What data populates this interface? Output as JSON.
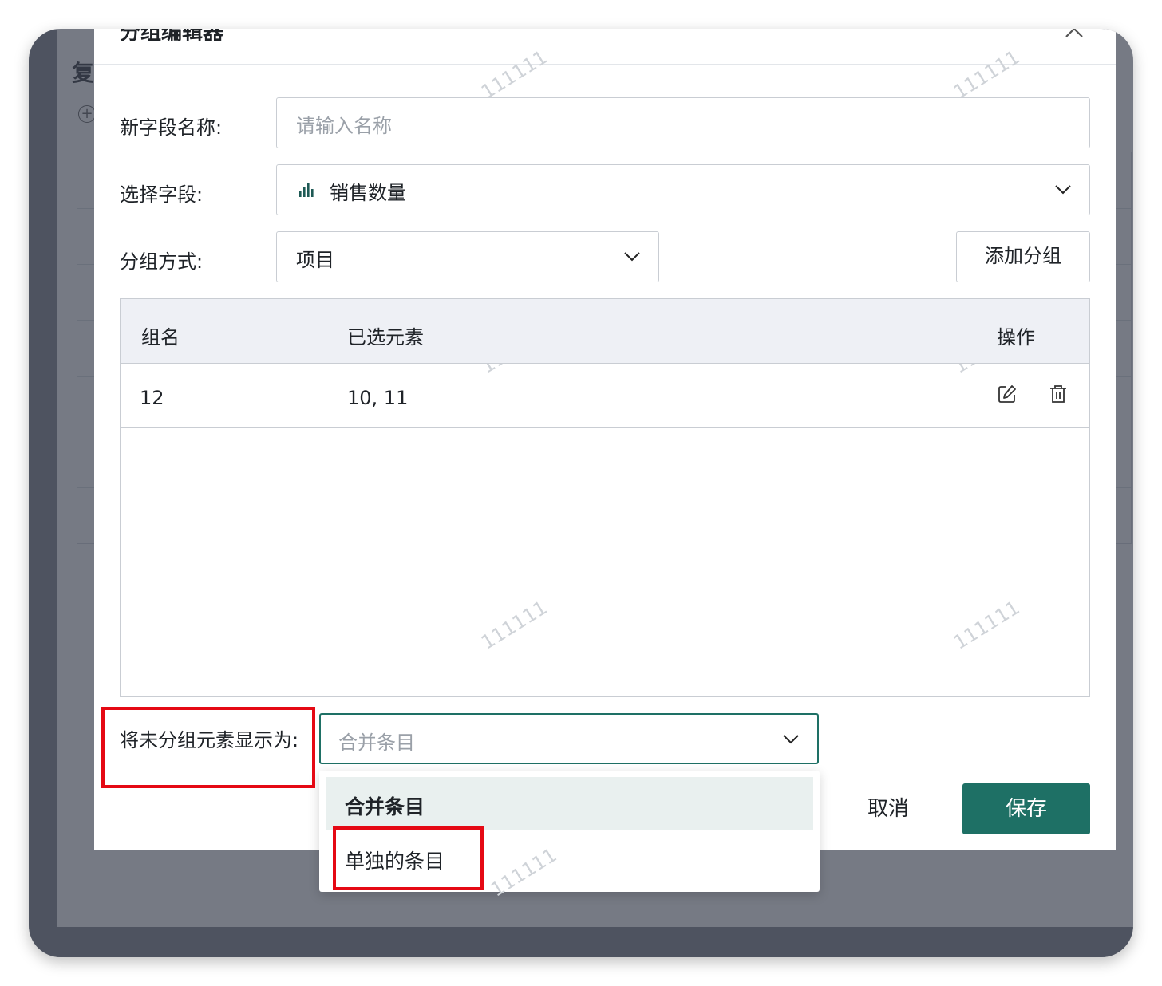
{
  "background": {
    "title": "复"
  },
  "dialog": {
    "title": "分组编辑器",
    "new_field_label": "新字段名称:",
    "new_field_placeholder": "请输入名称",
    "select_field_label": "选择字段:",
    "select_field_value": "销售数量",
    "select_field_icon": "bar-chart-icon",
    "group_method_label": "分组方式:",
    "group_method_value": "项目",
    "add_group_label": "添加分组",
    "table": {
      "headers": [
        "组名",
        "已选元素",
        "操作"
      ],
      "rows": [
        {
          "name": "12",
          "elements": "10, 11"
        }
      ]
    },
    "unmatched_label": "将未分组元素显示为:",
    "unmatched_value": "合并条目",
    "dropdown_options": [
      "合并条目",
      "单独的条目"
    ],
    "cancel_label": "取消",
    "save_label": "保存",
    "watermark": "111111",
    "colors": {
      "primary": "#1e7065",
      "highlight": "#e50914",
      "overlay": "#7a7e88"
    }
  }
}
